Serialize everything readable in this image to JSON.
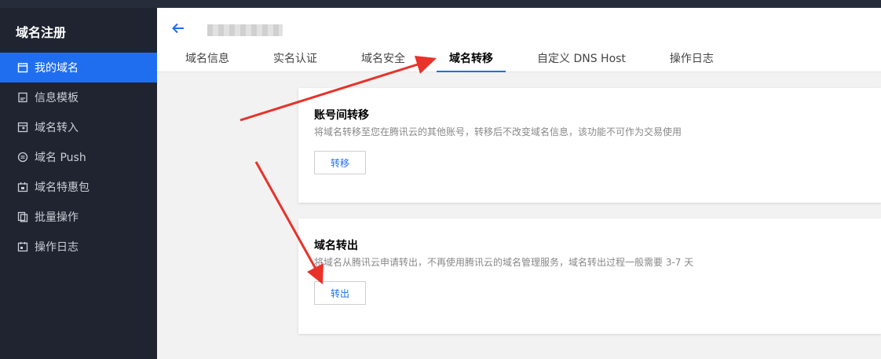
{
  "app": {
    "title": "域名注册"
  },
  "sidebar": {
    "items": [
      {
        "label": "我的域名",
        "icon": "calendar-icon",
        "active": true
      },
      {
        "label": "信息模板",
        "icon": "document-icon"
      },
      {
        "label": "域名转入",
        "icon": "transfer-in-icon"
      },
      {
        "label": "域名 Push",
        "icon": "push-icon"
      },
      {
        "label": "域名特惠包",
        "icon": "gift-icon"
      },
      {
        "label": "批量操作",
        "icon": "copy-icon"
      },
      {
        "label": "操作日志",
        "icon": "log-icon"
      }
    ]
  },
  "header": {
    "tabs": [
      {
        "label": "域名信息"
      },
      {
        "label": "实名认证"
      },
      {
        "label": "域名安全"
      },
      {
        "label": "域名转移",
        "active": true
      },
      {
        "label": "自定义 DNS Host"
      },
      {
        "label": "操作日志"
      }
    ]
  },
  "cards": [
    {
      "title": "账号间转移",
      "desc": "将域名转移至您在腾讯云的其他账号，转移后不改变域名信息，该功能不可作为交易使用",
      "button": "转移"
    },
    {
      "title": "域名转出",
      "desc": "将域名从腾讯云申请转出，不再使用腾讯云的域名管理服务，域名转出过程一般需要 3-7 天",
      "button": "转出"
    }
  ],
  "colors": {
    "accent": "#1f6ef0",
    "sidebar_bg": "#1f2430",
    "annotation": "#e8322a"
  }
}
